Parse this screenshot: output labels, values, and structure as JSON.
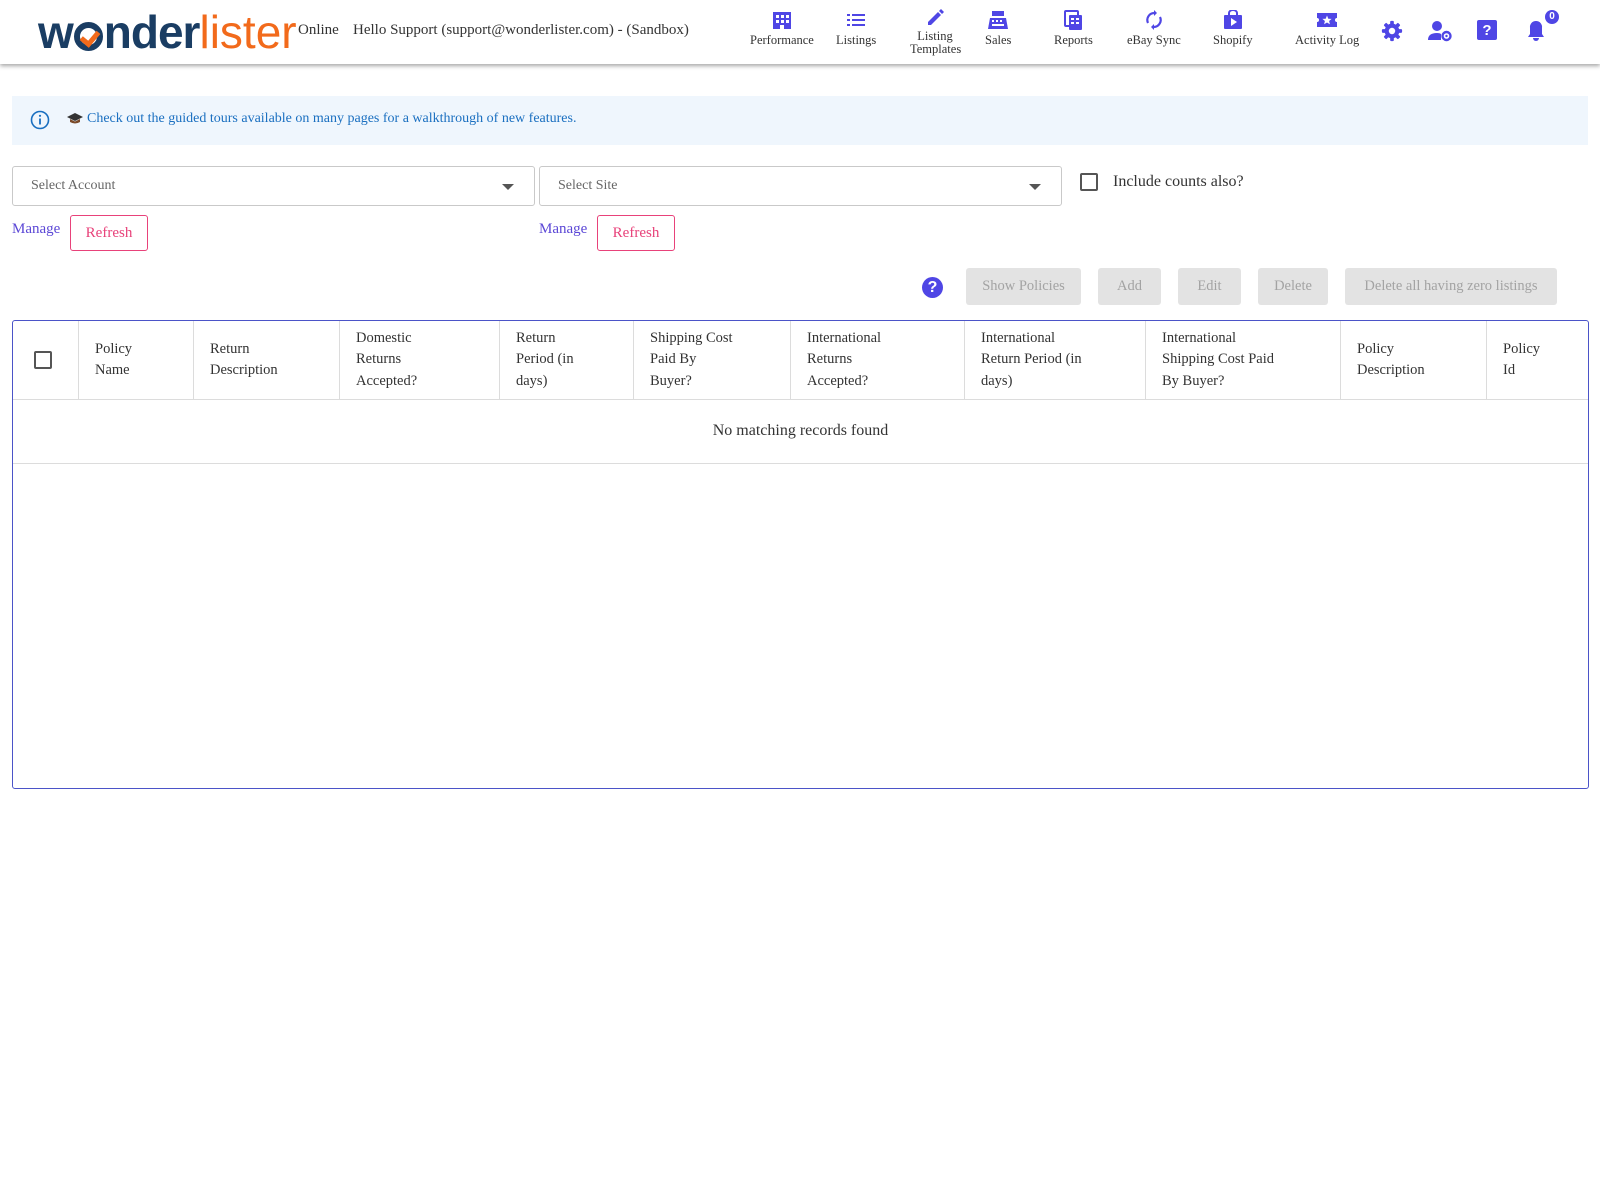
{
  "brand": {
    "name_part1": "w",
    "name_part2": "nder",
    "name_part3": "lister"
  },
  "header": {
    "status": "Online",
    "greeting": "Hello Support (support@wonderlister.com) - (Sandbox)",
    "nav": [
      {
        "label": "Performance",
        "icon": "building-icon"
      },
      {
        "label": "Listings",
        "icon": "list-icon"
      },
      {
        "label": "Listing Templates",
        "icon": "pencil-icon"
      },
      {
        "label": "Sales",
        "icon": "register-icon"
      },
      {
        "label": "Reports",
        "icon": "reports-icon"
      },
      {
        "label": "eBay Sync",
        "icon": "sync-icon"
      },
      {
        "label": "Shopify",
        "icon": "shopify-bag-icon"
      },
      {
        "label": "Activity Log",
        "icon": "ticket-star-icon"
      }
    ],
    "notifications_count": "0"
  },
  "banner": {
    "text": "Check out the guided tours available on many pages for a walkthrough of new features."
  },
  "filters": {
    "account_placeholder": "Select Account",
    "site_placeholder": "Select Site",
    "include_counts_label": "Include counts also?",
    "include_counts_checked": false,
    "manage_label": "Manage",
    "refresh_label": "Refresh"
  },
  "toolbar": {
    "help": "?",
    "show_policies": "Show Policies",
    "add": "Add",
    "edit": "Edit",
    "delete": "Delete",
    "delete_zero": "Delete all having zero listings"
  },
  "table": {
    "columns": [
      "Policy Name",
      "Return Description",
      "Domestic Returns Accepted?",
      "Return Period (in days)",
      "Shipping Cost Paid By Buyer?",
      "International Returns Accepted?",
      "International Return Period (in days)",
      "International Shipping Cost Paid By Buyer?",
      "Policy Description",
      "Policy Id"
    ],
    "column_lines": [
      [
        "Policy",
        "Name"
      ],
      [
        "Return",
        "Description"
      ],
      [
        "Domestic",
        "Returns",
        "Accepted?"
      ],
      [
        "Return",
        "Period (in",
        "days)"
      ],
      [
        "Shipping Cost",
        "Paid By",
        "Buyer?"
      ],
      [
        "International",
        "Returns",
        "Accepted?"
      ],
      [
        "International",
        "Return Period (in",
        "days)"
      ],
      [
        "International",
        "Shipping Cost Paid",
        "By Buyer?"
      ],
      [
        "Policy",
        "Description"
      ],
      [
        "Policy",
        "Id"
      ]
    ],
    "empty_message": "No matching records found"
  },
  "colors": {
    "accent": "#4f46e5",
    "brand_dark": "#1a3d63",
    "brand_orange": "#f26a1b",
    "refresh": "#e8427a",
    "banner_bg": "#eff6fd",
    "banner_text": "#1a6fc0"
  }
}
